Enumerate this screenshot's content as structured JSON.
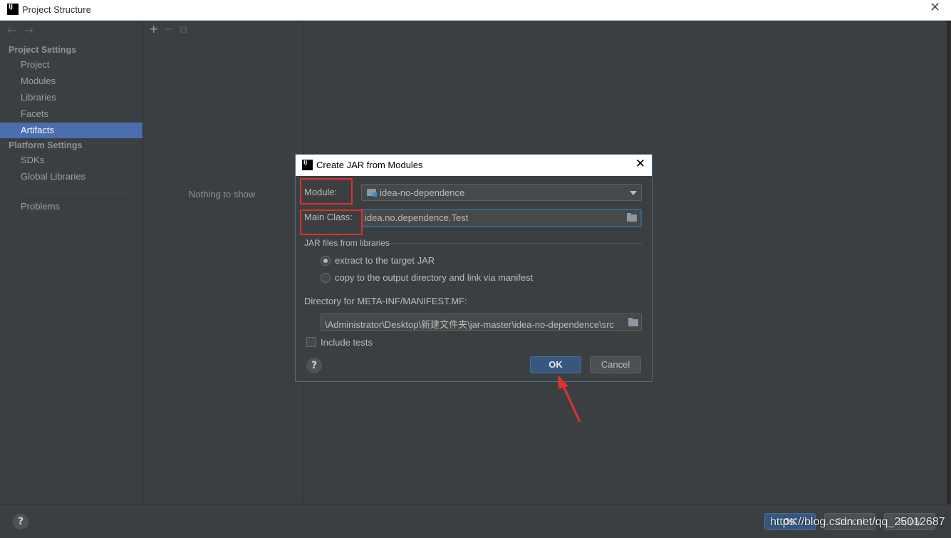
{
  "window": {
    "title": "Project Structure",
    "logo": "IJ"
  },
  "sidebar": {
    "project_settings": "Project Settings",
    "items": [
      "Project",
      "Modules",
      "Libraries",
      "Facets",
      "Artifacts"
    ],
    "platform_settings": "Platform Settings",
    "platform_items": [
      "SDKs",
      "Global Libraries"
    ],
    "problems": "Problems",
    "selected": "Artifacts"
  },
  "middle": {
    "empty_text": "Nothing to show"
  },
  "bottom": {
    "help": "?",
    "ok": "OK",
    "cancel": "Cancel",
    "apply": "Apply"
  },
  "dialog": {
    "title": "Create JAR from Modules",
    "module_label": "Module:",
    "module_value": "idea-no-dependence",
    "main_class_label": "Main Class:",
    "main_class_value": "idea.no.dependence.Test",
    "jar_group_title": "JAR files from libraries",
    "radio_extract": "extract to the target JAR",
    "radio_copy": "copy to the output directory and link via manifest",
    "selected_radio": "extract",
    "manifest_label": "Directory for META-INF/MANIFEST.MF:",
    "manifest_value": "\\Administrator\\Desktop\\新建文件夹\\jar-master\\idea-no-dependence\\src",
    "include_tests": "Include tests",
    "include_tests_checked": false,
    "help": "?",
    "ok": "OK",
    "cancel": "Cancel"
  },
  "watermark": "https://blog.csdn.net/qq_25012687",
  "colors": {
    "accent": "#4b6eaf",
    "annotation": "#e03030",
    "primary_button": "#365880"
  }
}
